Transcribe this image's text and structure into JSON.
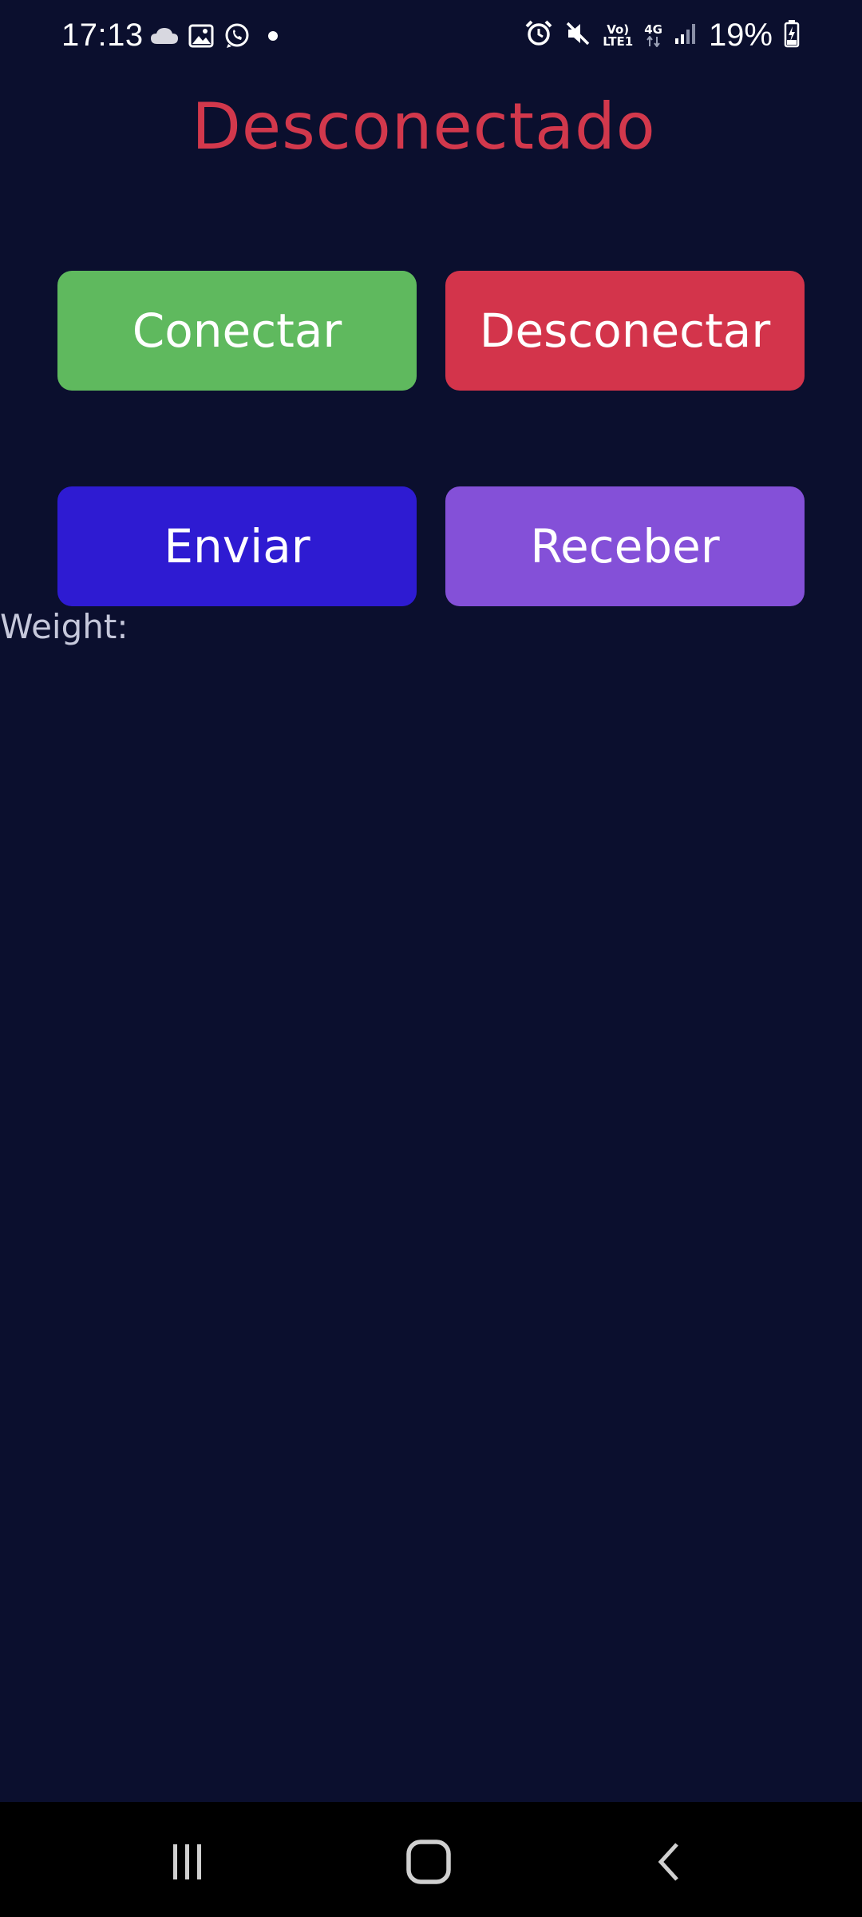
{
  "status_bar": {
    "time": "17:13",
    "battery_percent": "19%",
    "network_volte": "Vo)",
    "network_lte": "LTE1",
    "network_type": "4G",
    "left_icons": [
      "cloud-icon",
      "image-icon",
      "whatsapp-icon",
      "dot-icon"
    ],
    "right_icons": [
      "alarm-icon",
      "mute-icon",
      "volte-icon",
      "4g-icon",
      "signal-icon",
      "battery-charging-icon"
    ]
  },
  "main": {
    "status_title": "Desconectado",
    "buttons": {
      "connect": "Conectar",
      "disconnect": "Desconectar",
      "send": "Enviar",
      "receive": "Receber"
    },
    "weight_label": "Weight:"
  },
  "colors": {
    "background": "#0b0f2e",
    "title": "#d2384c",
    "connect": "#5fb95e",
    "disconnect": "#d3344b",
    "send": "#2e1bd2",
    "receive": "#8450d8"
  },
  "nav_bar": {
    "icons": [
      "recent-apps-icon",
      "home-icon",
      "back-icon"
    ]
  }
}
